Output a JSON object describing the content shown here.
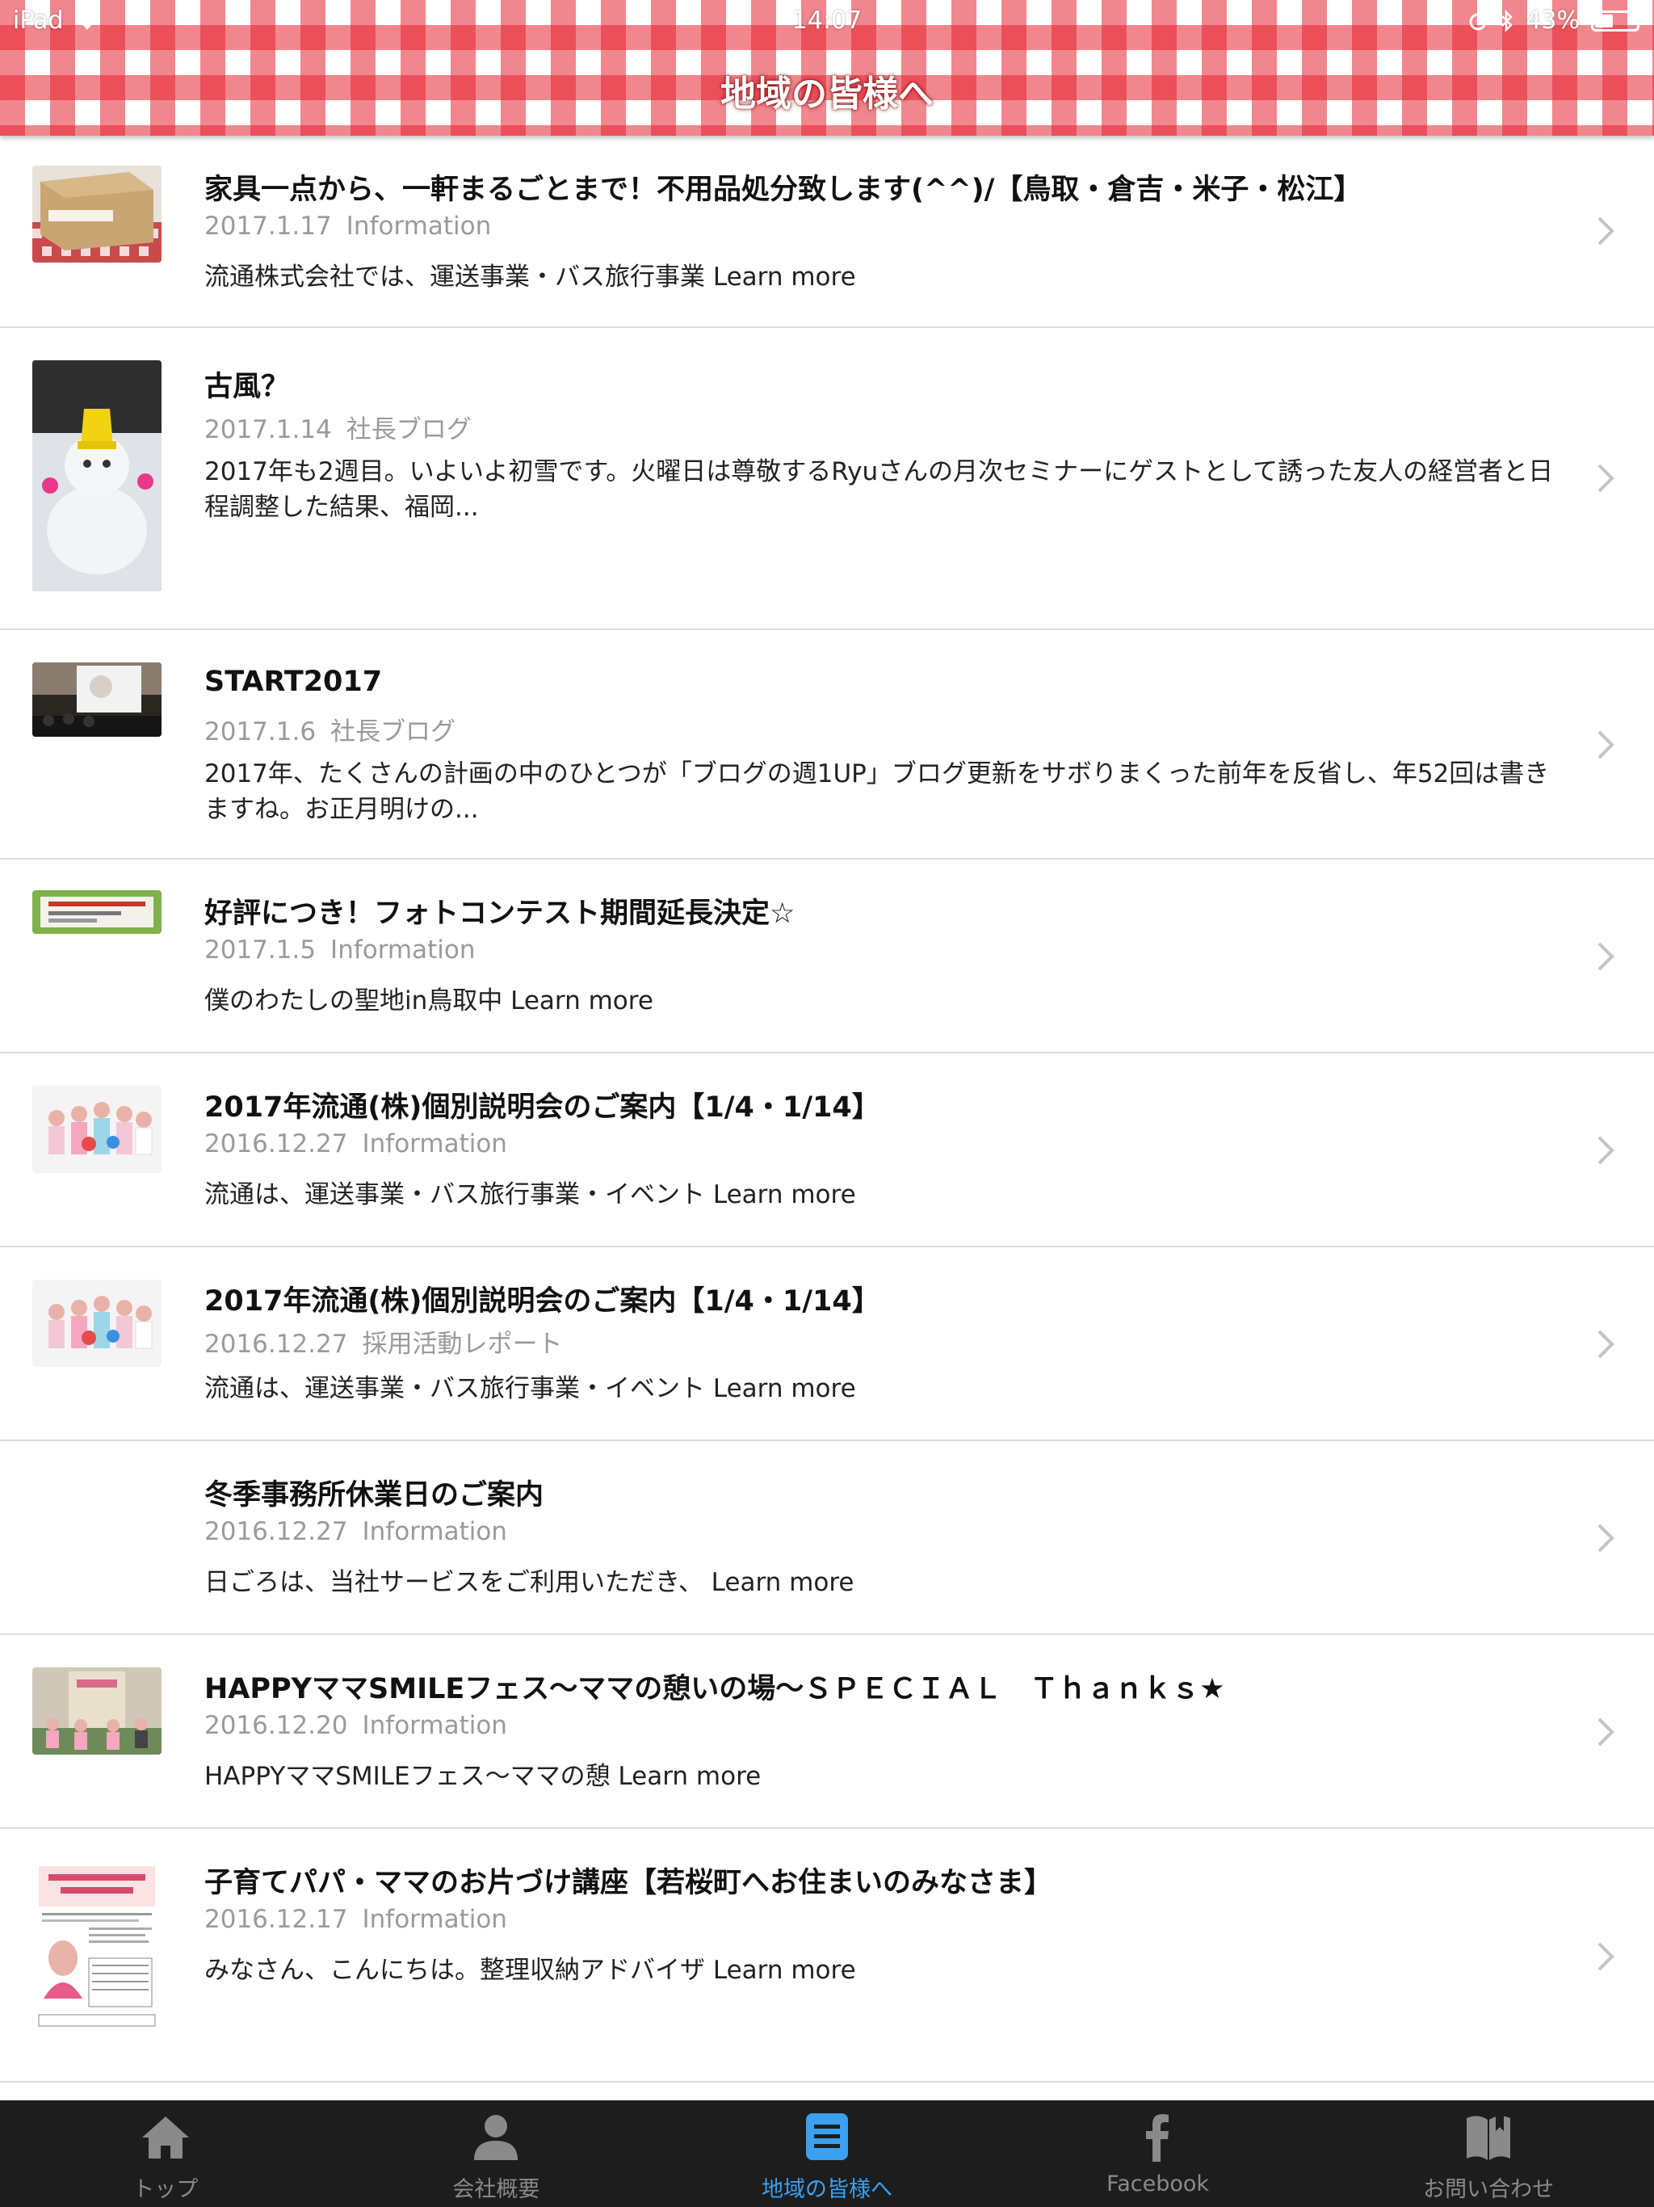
{
  "status_bar": {
    "device": "iPad",
    "time": "14:07",
    "battery": "43%",
    "battery_level": 0.43
  },
  "header": {
    "title": "地域の皆様へ"
  },
  "list": [
    {
      "title": "家具一点から、一軒まるごとまで！不用品処分致します(^^)/【鳥取・倉吉・米子・松江】",
      "date": "2017.1.17",
      "category": "Information",
      "excerpt": "流通株式会社では、運送事業・バス旅行事業 Learn more"
    },
    {
      "title": "古風？",
      "date": "2017.1.14",
      "category": "社長ブログ",
      "excerpt": "2017年も2週目。いよいよ初雪です。火曜日は尊敬するRyuさんの月次セミナーにゲストとして誘った友人の経営者と日程調整した結果、福岡..."
    },
    {
      "title": "START2017",
      "date": "2017.1.6",
      "category": "社長ブログ",
      "excerpt": "2017年、たくさんの計画の中のひとつが「ブログの週1UP」ブログ更新をサボりまくった前年を反省し、年52回は書きますね。お正月明けの..."
    },
    {
      "title": "好評につき！フォトコンテスト期間延長決定☆",
      "date": "2017.1.5",
      "category": "Information",
      "excerpt": "僕のわたしの聖地in鳥取中 Learn more"
    },
    {
      "title": "2017年流通(株)個別説明会のご案内【1/4・1/14】",
      "date": "2016.12.27",
      "category": "Information",
      "excerpt": "流通は、運送事業・バス旅行事業・イベント Learn more"
    },
    {
      "title": "2017年流通(株)個別説明会のご案内【1/4・1/14】",
      "date": "2016.12.27",
      "category": "採用活動レポート",
      "excerpt": "流通は、運送事業・バス旅行事業・イベント Learn more"
    },
    {
      "title": "冬季事務所休業日のご案内",
      "date": "2016.12.27",
      "category": "Information",
      "excerpt": "日ごろは、当社サービスをご利用いただき、 Learn more"
    },
    {
      "title": "HAPPYママSMILEフェス〜ママの憩いの場〜ＳＰＥＣＩＡＬ　Ｔｈａｎｋｓ★",
      "date": "2016.12.20",
      "category": "Information",
      "excerpt": "HAPPYママSMILEフェス〜ママの憩 Learn more"
    },
    {
      "title": "子育てパパ・ママのお片づけ講座【若桜町へお住まいのみなさま】",
      "date": "2016.12.17",
      "category": "Information",
      "excerpt": "みなさん、こんにちは。整理収納アドバイザ Learn more"
    }
  ],
  "tabs": [
    {
      "label": "トップ",
      "icon": "home-icon"
    },
    {
      "label": "会社概要",
      "icon": "person-icon"
    },
    {
      "label": "地域の皆様へ",
      "icon": "document-icon",
      "active": true
    },
    {
      "label": "Facebook",
      "icon": "facebook-icon"
    },
    {
      "label": "お問い合わせ",
      "icon": "book-icon"
    }
  ],
  "colors": {
    "header_red": "#e62430",
    "tab_active": "#3aa0f0",
    "tab_inactive": "#8a8a8a",
    "tabbar_bg": "#1d1d1d"
  }
}
